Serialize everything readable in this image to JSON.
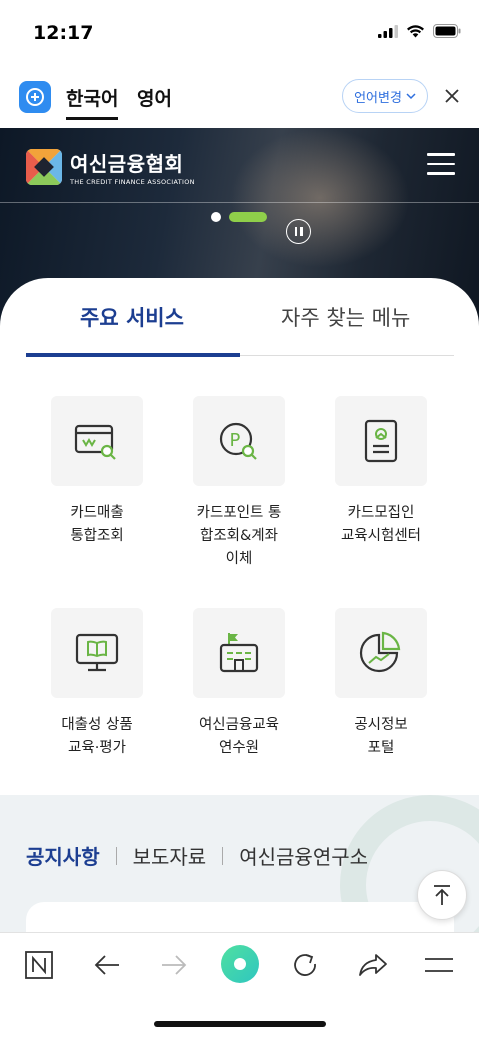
{
  "status_bar": {
    "time": "12:17"
  },
  "translate_bar": {
    "active_language": "한국어",
    "other_language": "영어",
    "change_language_label": "언어변경"
  },
  "hero": {
    "logo_title": "여신금융협회",
    "logo_subtitle": "THE CREDIT FINANCE ASSOCIATION"
  },
  "tabs": {
    "main": "주요 서비스",
    "other": "자주 찾는 메뉴"
  },
  "services": [
    {
      "label": "카드매출\n통합조회",
      "icon": "card-search-icon"
    },
    {
      "label": "카드포인트 통\n합조회&계좌\n이체",
      "icon": "point-search-icon"
    },
    {
      "label": "카드모집인\n교육시험센터",
      "icon": "document-certificate-icon"
    },
    {
      "label": "대출성 상품\n교육·평가",
      "icon": "monitor-book-icon"
    },
    {
      "label": "여신금융교육\n연수원",
      "icon": "building-flag-icon"
    },
    {
      "label": "공시정보\n포털",
      "icon": "pie-chart-icon"
    }
  ],
  "news": {
    "tab_active": "공지사항",
    "tab_2": "보도자료",
    "tab_3": "여신금융연구소"
  },
  "colors": {
    "brand_blue": "#1c3e91",
    "accent_green": "#8fcf4a",
    "icon_green": "#6ab545"
  }
}
